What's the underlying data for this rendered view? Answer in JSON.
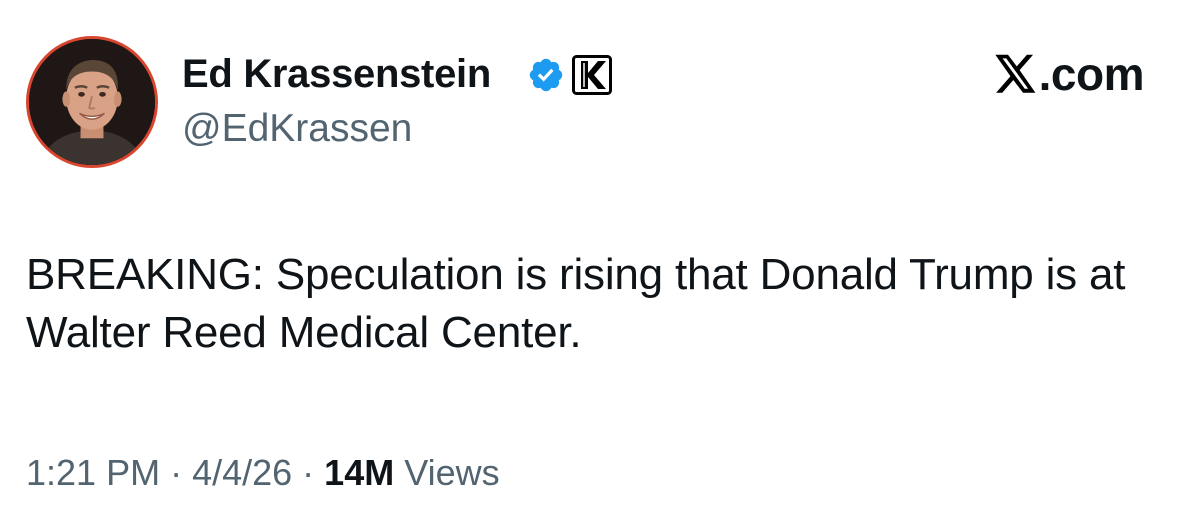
{
  "author": {
    "display_name": "Ed Krassenstein",
    "handle": "@EdKrassen",
    "verified": true,
    "verified_color": "#1d9bf0",
    "avatar_icon": "profile-photo",
    "affiliate_badge": "k-letter-badge"
  },
  "site": {
    "label": ".com",
    "icon": "x-logo-icon"
  },
  "tweet": {
    "text": "BREAKING: Speculation is rising that Donald Trump is at Walter Reed Medical Center."
  },
  "meta": {
    "time": "1:21 PM",
    "separator": " · ",
    "date": "4/4/26",
    "views_count": "14M",
    "views_label": "Views"
  },
  "colors": {
    "text_primary": "#0f1419",
    "text_secondary": "#536471",
    "avatar_ring": "#d9462f"
  }
}
